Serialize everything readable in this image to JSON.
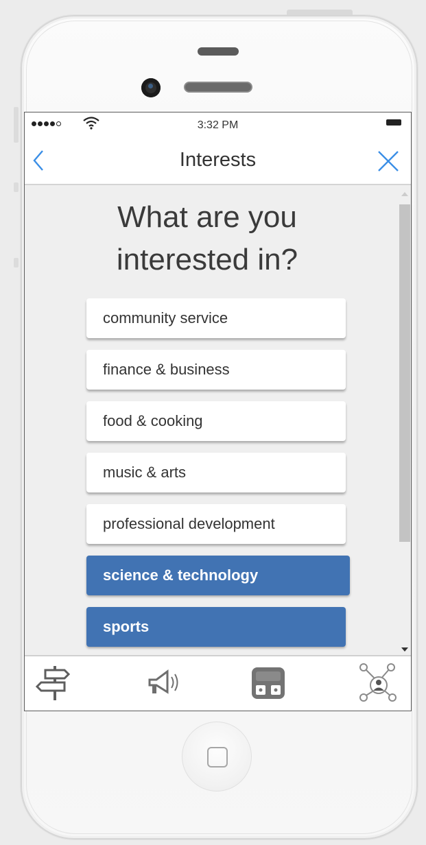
{
  "status_bar": {
    "time": "3:32 PM"
  },
  "nav": {
    "title": "Interests",
    "back_icon": "chevron-left-icon",
    "close_icon": "close-icon"
  },
  "content": {
    "heading_line1": "What are you",
    "heading_line2": "interested in?",
    "interests": [
      {
        "label": "community service",
        "selected": false
      },
      {
        "label": "finance & business",
        "selected": false
      },
      {
        "label": "food & cooking",
        "selected": false
      },
      {
        "label": "music & arts",
        "selected": false
      },
      {
        "label": "professional development",
        "selected": false
      },
      {
        "label": "science & technology",
        "selected": true
      },
      {
        "label": "sports",
        "selected": true
      }
    ]
  },
  "tab_bar": {
    "tabs": [
      {
        "icon": "signpost-icon"
      },
      {
        "icon": "megaphone-icon"
      },
      {
        "icon": "backpack-icon"
      },
      {
        "icon": "network-person-icon"
      }
    ]
  },
  "colors": {
    "accent": "#4173b3",
    "nav_icon": "#3a8ee6"
  }
}
